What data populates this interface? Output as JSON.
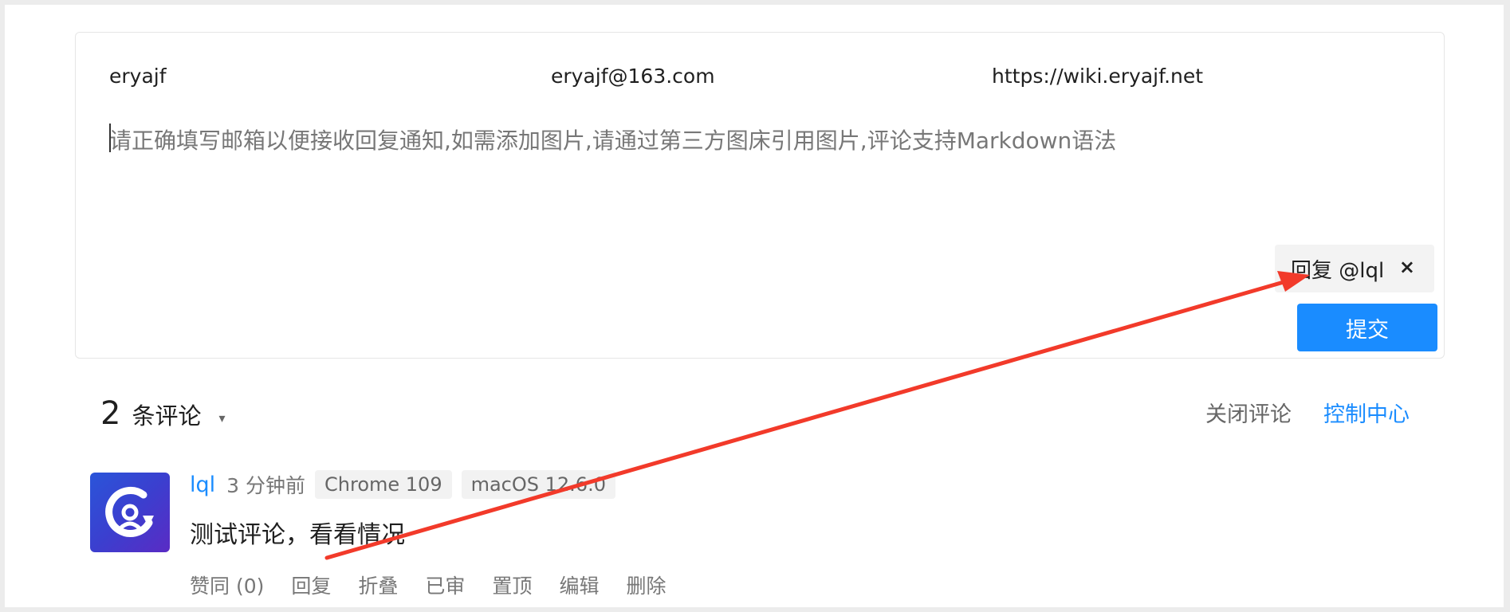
{
  "form": {
    "nickname": "eryajf",
    "email": "eryajf@163.com",
    "website": "https://wiki.eryajf.net",
    "textarea_placeholder": "请正确填写邮箱以便接收回复通知,如需添加图片,请通过第三方图床引用图片,评论支持Markdown语法",
    "reply_chip_label": "回复 @lql",
    "reply_chip_close": "×",
    "submit_label": "提交"
  },
  "comments_header": {
    "count": "2",
    "label": "条评论",
    "sort_caret": "▾",
    "close_comments": "关闭评论",
    "control_center": "控制中心"
  },
  "comment": {
    "author": "lql",
    "time": "3 分钟前",
    "browser": "Chrome 109",
    "os": "macOS 12.6.0",
    "text": "测试评论，看看情况",
    "actions": {
      "like": "赞同 (0)",
      "reply": "回复",
      "collapse": "折叠",
      "approved": "已审",
      "pin": "置顶",
      "edit": "编辑",
      "delete": "删除"
    }
  },
  "annotation": {
    "arrow_color": "#f23a2a"
  },
  "colors": {
    "accent": "#1a8cff",
    "text": "#1f1f1f",
    "muted": "#777777"
  }
}
